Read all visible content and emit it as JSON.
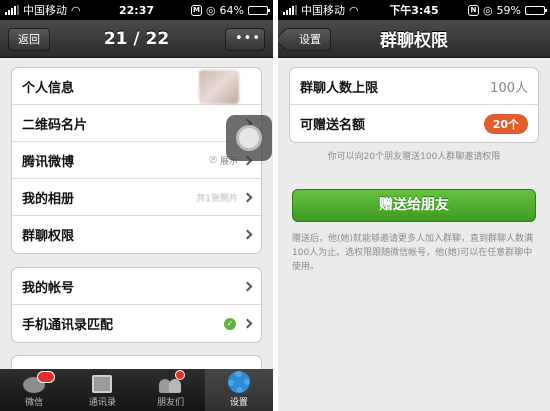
{
  "left": {
    "status": {
      "carrier": "中国移动",
      "time": "22:37",
      "battery": "64%",
      "battery_level": 0.64
    },
    "nav": {
      "back": "返回",
      "title": "21 / 22",
      "more": "•••"
    },
    "group1": [
      {
        "label": "个人信息"
      },
      {
        "label": "二维码名片"
      },
      {
        "label": "腾讯微博",
        "value": "展示"
      },
      {
        "label": "我的相册",
        "value": "共1张照片"
      },
      {
        "label": "群聊权限"
      }
    ],
    "group2": [
      {
        "label": "我的帐号"
      },
      {
        "label": "手机通讯录匹配"
      }
    ],
    "tabs": [
      "微信",
      "通讯录",
      "朋友们",
      "设置"
    ]
  },
  "right": {
    "status": {
      "carrier": "中国移动",
      "time": "下午3:45",
      "battery": "59%",
      "battery_level": 0.59
    },
    "nav": {
      "back": "设置",
      "title": "群聊权限"
    },
    "rows": [
      {
        "label": "群聊人数上限",
        "value": "100人"
      },
      {
        "label": "可赠送名额",
        "value": "20个"
      }
    ],
    "hint": "你可以向20个朋友赠送100人群聊邀请权限",
    "button": "赠送给朋友",
    "note": "赠送后，他(她)就能够邀请更多人加入群聊，直到群聊人数满100人为止。选权限跟随微信帐号，他(她)可以在任意群聊中使用。",
    "colors": {
      "accent_green": "#4caf2c",
      "pill_orange": "#e45c2b"
    }
  }
}
